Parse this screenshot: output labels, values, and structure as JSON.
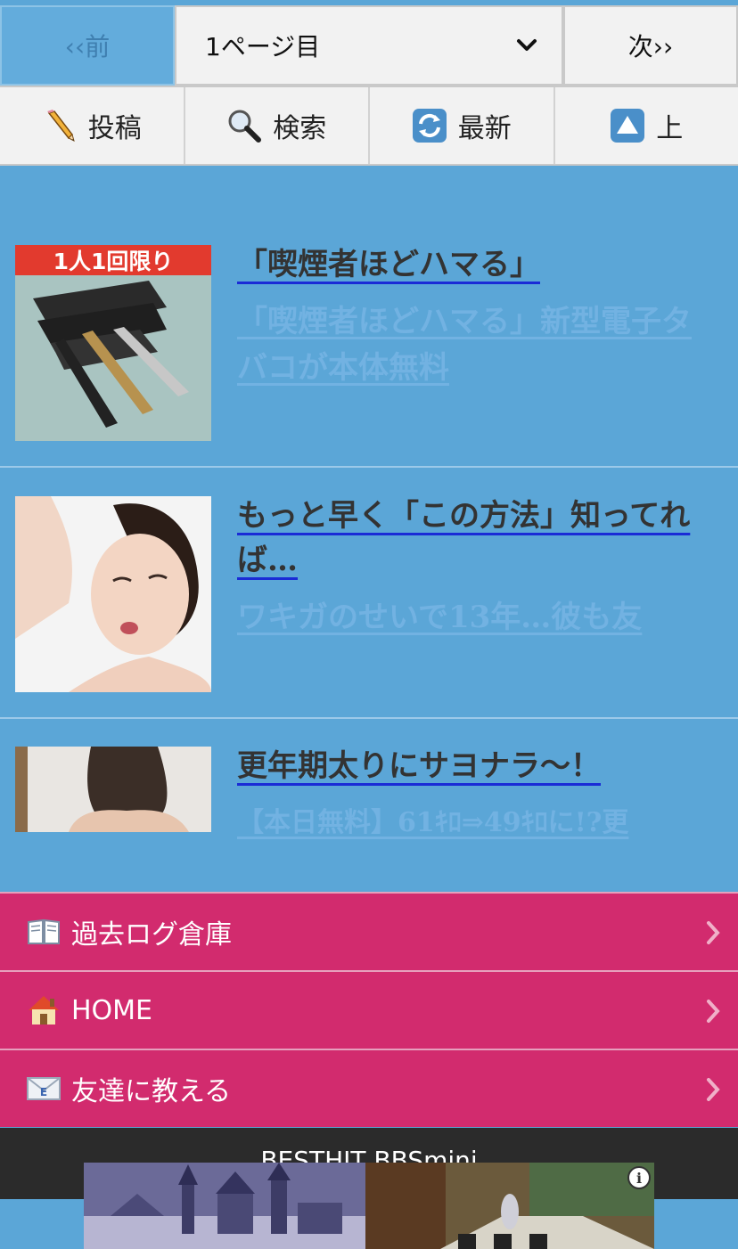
{
  "pager": {
    "prev_label": "‹‹前",
    "page_select_value": "1ページ目",
    "next_label": "次››"
  },
  "toolbar": {
    "post_label": "投稿",
    "search_label": "検索",
    "refresh_label": "最新",
    "top_label": "上"
  },
  "ads": [
    {
      "badge": "1人1回限り",
      "title": "「喫煙者ほどハマる」",
      "description": "「喫煙者ほどハマる」新型電子タバコが本体無料"
    },
    {
      "title": "もっと早く「この方法」知ってれば…",
      "description": "ワキガのせいで13年…彼も友"
    },
    {
      "title": "更年期太りにサヨナラ〜！",
      "description": "【本日無料】61ｷﾛ⇒49ｷﾛに!?更"
    }
  ],
  "menu": [
    {
      "icon": "book-icon",
      "label": "過去ログ倉庫"
    },
    {
      "icon": "house-icon",
      "label": "HOME"
    },
    {
      "icon": "email-icon",
      "label": "友達に教える"
    }
  ],
  "footer": {
    "text": "BESTHIT BBSmini"
  },
  "banner": {
    "info_label": "i"
  },
  "colors": {
    "background": "#5ba6d7",
    "menu": "#d22b6e",
    "footer": "#2b2b2b",
    "title_link": "#1a2bd6",
    "desc_link": "#72b2e2"
  }
}
